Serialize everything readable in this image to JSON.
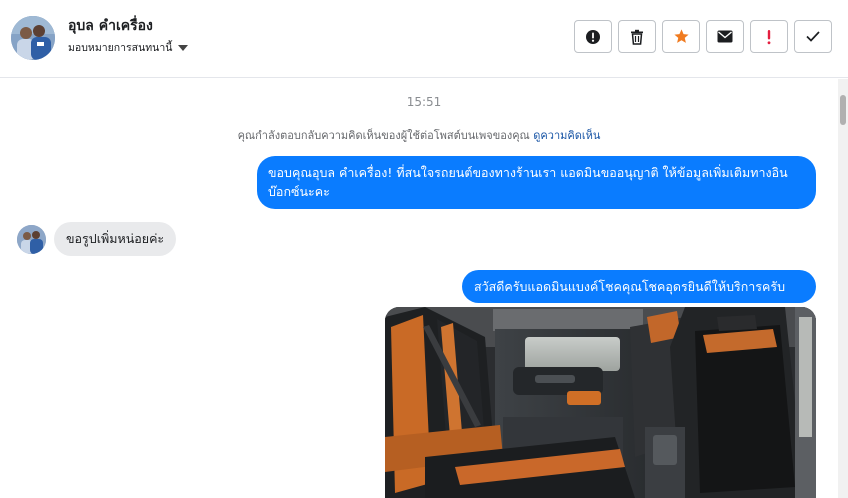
{
  "header": {
    "contact_name": "อุบล คำเครื่อง",
    "assign_label": "มอบหมายการสนทนานี้"
  },
  "actions": [
    {
      "name": "mark-spam-button",
      "icon": "alert-circle-icon"
    },
    {
      "name": "delete-button",
      "icon": "trash-icon"
    },
    {
      "name": "follow-up-star-button",
      "icon": "star-icon"
    },
    {
      "name": "mark-unread-button",
      "icon": "envelope-icon"
    },
    {
      "name": "priority-button",
      "icon": "exclamation-icon"
    },
    {
      "name": "mark-done-button",
      "icon": "check-icon"
    }
  ],
  "thread": {
    "timestamp": "15:51",
    "notice_text": "คุณกำลังตอบกลับความคิดเห็นของผู้ใช้ต่อโพสต์บนเพจของคุณ ",
    "notice_link": "ดูความคิดเห็น",
    "messages": [
      {
        "direction": "out",
        "text": "ขอบคุณอุบล คำเครื่อง! ที่สนใจรถยนต์ของทางร้านเรา แอดมินขออนุญาติ ให้ข้อมูลเพิ่มเติมทางอินบ๊อกซ์นะคะ"
      },
      {
        "direction": "in",
        "text": "ขอรูปเพิ่มหน่อยค่ะ"
      },
      {
        "direction": "out",
        "text": "สวัสดีครับแอดมินแบงค์โชคคุณโชคอุดรยินดีให้บริการครับ"
      }
    ]
  },
  "colors": {
    "outgoing_bubble": "#0a7cff",
    "incoming_bubble": "#e9eaec",
    "star": "#f07b20",
    "alert": "#e41e3f",
    "link": "#1a56a6"
  }
}
